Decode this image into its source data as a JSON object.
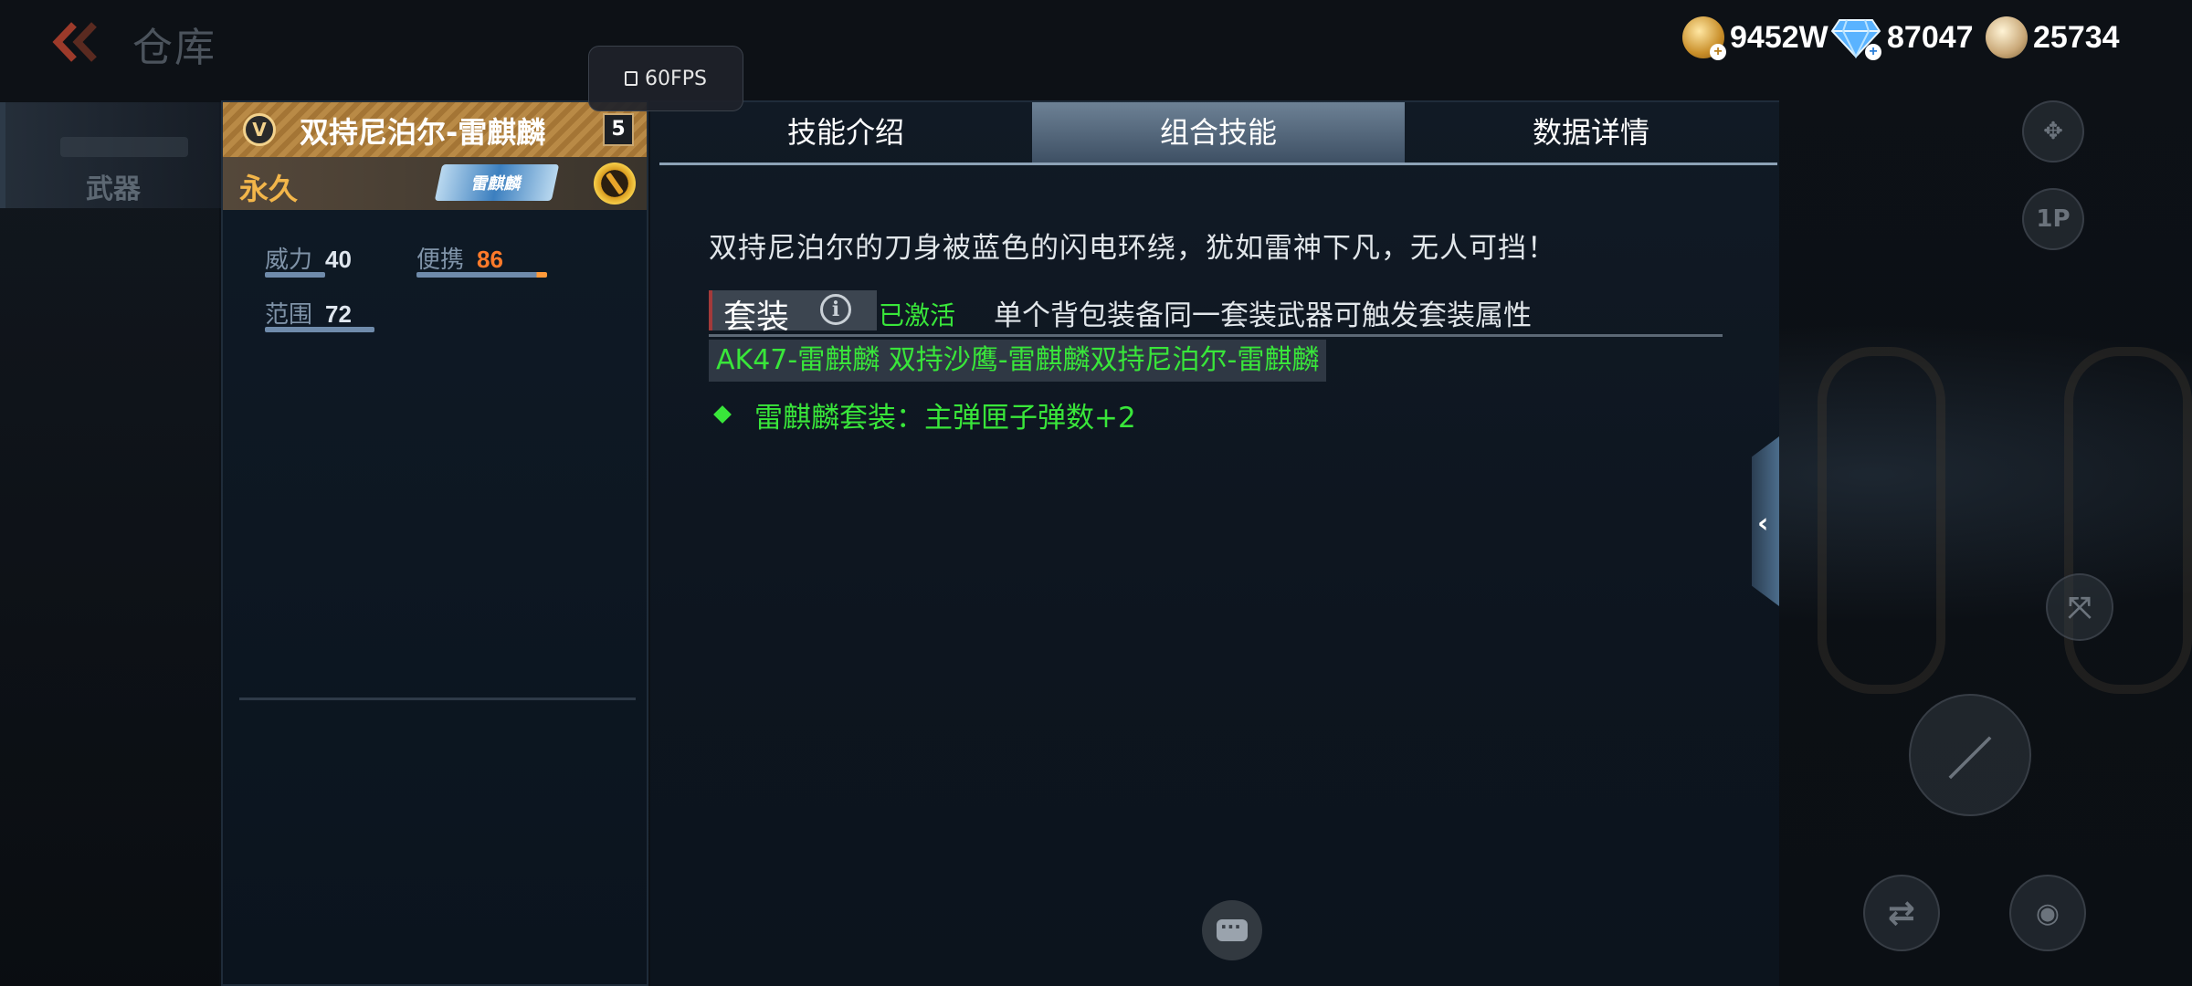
{
  "header": {
    "title": "仓库",
    "fps": "60FPS"
  },
  "currencies": [
    {
      "icon": "gold-coin-icon",
      "value": "9452W"
    },
    {
      "icon": "diamond-icon",
      "value": "87047"
    },
    {
      "icon": "honor-coin-icon",
      "value": "25734"
    }
  ],
  "nav": {
    "tab_weapon": "武器"
  },
  "weapon": {
    "rank": "V",
    "name": "双持尼泊尔-雷麒麟",
    "level": "5",
    "duration": "永久",
    "skin_tag": "雷麒麟",
    "stats": [
      {
        "label": "威力",
        "value": "40",
        "fill": 0.4
      },
      {
        "label": "便携",
        "value": "86",
        "fill": 0.86
      },
      {
        "label": "范围",
        "value": "72",
        "fill": 0.72
      }
    ]
  },
  "tabs": [
    {
      "label": "技能介绍",
      "active": false
    },
    {
      "label": "组合技能",
      "active": true
    },
    {
      "label": "数据详情",
      "active": false
    }
  ],
  "detail": {
    "description": "双持尼泊尔的刀身被蓝色的闪电环绕，犹如雷神下凡，无人可挡！",
    "set_label": "套装",
    "set_status": "已激活",
    "set_hint": "单个背包装备同一套装武器可触发套装属性",
    "set_members": "AK47-雷麒麟 双持沙鹰-雷麒麟双持尼泊尔-雷麒麟",
    "bonus": "雷麒麟套装：主弹匣子弹数+2"
  },
  "colors": {
    "accent_green": "#39e63a",
    "portability_orange": "#ff7a2a",
    "duration_gold": "#f3b64a"
  }
}
